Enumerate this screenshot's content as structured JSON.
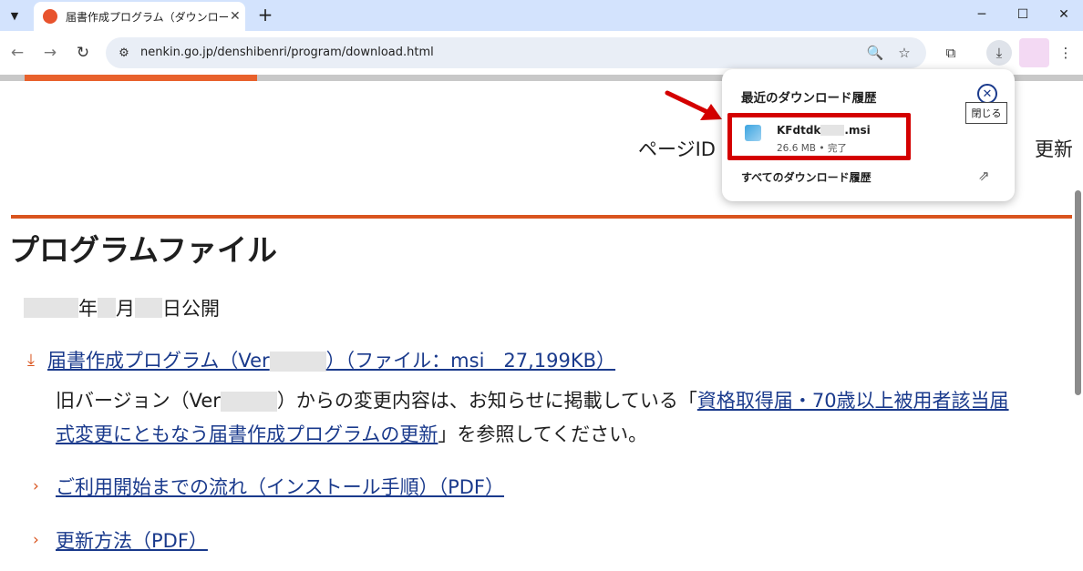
{
  "browser": {
    "tab_title": "届書作成プログラム（ダウンロードペ",
    "tab_favicon_text": "年金",
    "url": "nenkin.go.jp/denshibenri/program/download.html"
  },
  "icons": {
    "tab_list": "chevron-down-icon",
    "tab_close": "close-icon",
    "new_tab": "plus-icon",
    "back": "back-arrow-icon",
    "forward": "forward-arrow-icon",
    "reload": "reload-icon",
    "site_info": "tune-icon",
    "zoom": "zoom-icon",
    "bookmark": "star-icon",
    "extensions": "puzzle-icon",
    "download": "download-icon",
    "menu": "kebab-menu-icon"
  },
  "page": {
    "page_id_label": "ページID",
    "update_label": "更新",
    "title": "プログラムファイル",
    "pub_date": {
      "year": "年",
      "month": "月",
      "day": "日公開"
    },
    "main_link": {
      "prefix": "届書作成プログラム（Ver",
      "suffix": "）（ファイル：msi　27,199KB）"
    },
    "note": {
      "line1_pre": "旧バージョン（Ver",
      "line1_mid": "）からの変更内容は、お知らせに掲載している「",
      "line1_link": "資格取得届・70歳以上被用者該当届",
      "line2_link": "式変更にともなう届書作成プログラムの更新",
      "line2_post": "」を参照してください。"
    },
    "links": [
      "ご利用開始までの流れ（インストール手順）（PDF）",
      "更新方法（PDF）"
    ]
  },
  "download_popup": {
    "title": "最近のダウンロード履歴",
    "close_tooltip": "閉じる",
    "item": {
      "name_prefix": "KFdtdk",
      "name_suffix": ".msi",
      "meta": "26.6 MB • 完了"
    },
    "all_history": "すべてのダウンロード履歴"
  },
  "colors": {
    "accent": "#d9541e",
    "link": "#1a3a8c",
    "highlight_box": "#d40000",
    "tabbar": "#d3e3fd"
  }
}
